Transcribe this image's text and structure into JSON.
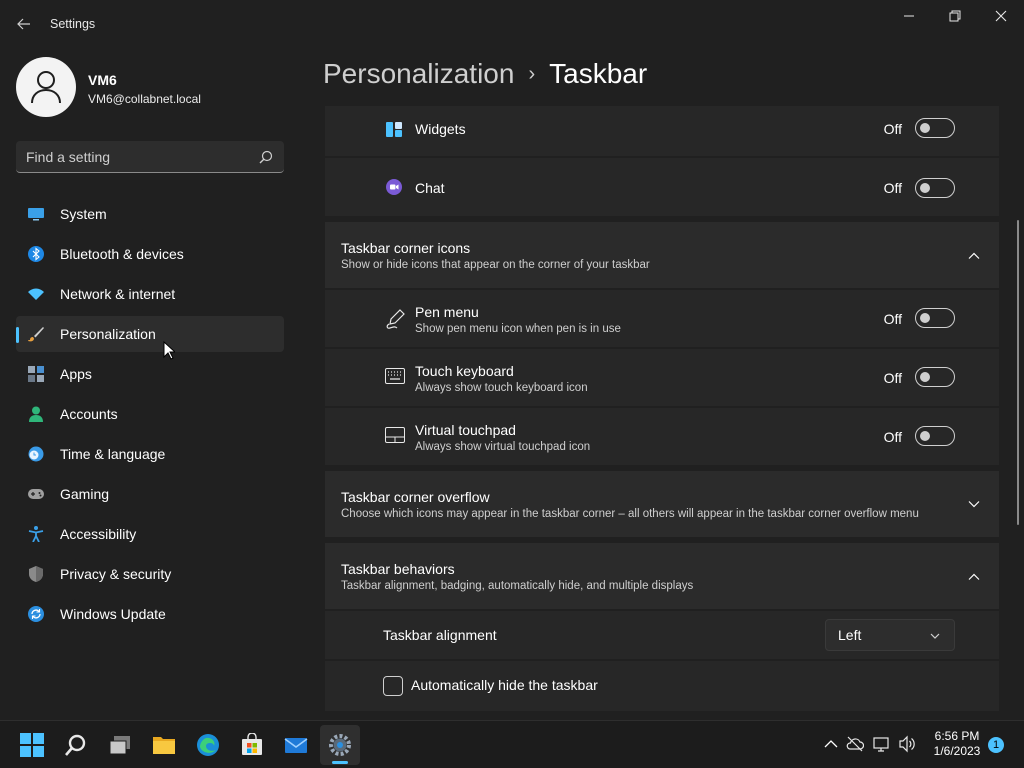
{
  "window": {
    "title": "Settings",
    "back_icon": "arrow-left-icon",
    "controls": [
      "minimize-icon",
      "restore-icon",
      "close-icon"
    ]
  },
  "profile": {
    "name": "VM6",
    "email": "VM6@collabnet.local"
  },
  "search": {
    "placeholder": "Find a setting"
  },
  "sidebar": {
    "items": [
      {
        "label": "System",
        "icon": "monitor-icon",
        "color": "#3aa0e8"
      },
      {
        "label": "Bluetooth & devices",
        "icon": "bluetooth-icon",
        "color": "#1e88e5"
      },
      {
        "label": "Network & internet",
        "icon": "wifi-icon",
        "color": "#4cc2ff"
      },
      {
        "label": "Personalization",
        "icon": "paintbrush-icon",
        "color": "#e8a040",
        "active": true
      },
      {
        "label": "Apps",
        "icon": "apps-icon",
        "color": "#9aa8b8"
      },
      {
        "label": "Accounts",
        "icon": "person-icon",
        "color": "#2fb67a"
      },
      {
        "label": "Time & language",
        "icon": "globe-clock-icon",
        "color": "#3a9be8"
      },
      {
        "label": "Gaming",
        "icon": "gamepad-icon",
        "color": "#a0a0a0"
      },
      {
        "label": "Accessibility",
        "icon": "accessibility-icon",
        "color": "#3aa0e8"
      },
      {
        "label": "Privacy & security",
        "icon": "shield-icon",
        "color": "#8a8a8a"
      },
      {
        "label": "Windows Update",
        "icon": "update-icon",
        "color": "#2b8fe0"
      }
    ]
  },
  "breadcrumb": {
    "parent": "Personalization",
    "separator": "›",
    "current": "Taskbar"
  },
  "taskbar_items": {
    "widgets": {
      "label": "Widgets",
      "state": "Off"
    },
    "chat": {
      "label": "Chat",
      "state": "Off"
    }
  },
  "corner_icons": {
    "title": "Taskbar corner icons",
    "description": "Show or hide icons that appear on the corner of your taskbar",
    "pen_menu": {
      "label": "Pen menu",
      "description": "Show pen menu icon when pen is in use",
      "state": "Off"
    },
    "touch_keyboard": {
      "label": "Touch keyboard",
      "description": "Always show touch keyboard icon",
      "state": "Off"
    },
    "virtual_touchpad": {
      "label": "Virtual touchpad",
      "description": "Always show virtual touchpad icon",
      "state": "Off"
    }
  },
  "corner_overflow": {
    "title": "Taskbar corner overflow",
    "description": "Choose which icons may appear in the taskbar corner – all others will appear in the taskbar corner overflow menu"
  },
  "behaviors": {
    "title": "Taskbar behaviors",
    "description": "Taskbar alignment, badging, automatically hide, and multiple displays",
    "alignment": {
      "label": "Taskbar alignment",
      "value": "Left"
    },
    "auto_hide": {
      "label": "Automatically hide the taskbar",
      "checked": false
    }
  },
  "os_taskbar": {
    "apps": [
      "start-icon",
      "search-icon",
      "task-view-icon",
      "file-explorer-icon",
      "edge-icon",
      "store-icon",
      "mail-icon",
      "settings-icon"
    ],
    "time": "6:56 PM",
    "date": "1/6/2023",
    "notification_count": "1"
  },
  "colors": {
    "accent": "#4cc2ff",
    "background": "#202020",
    "card": "#2b2b2b"
  }
}
